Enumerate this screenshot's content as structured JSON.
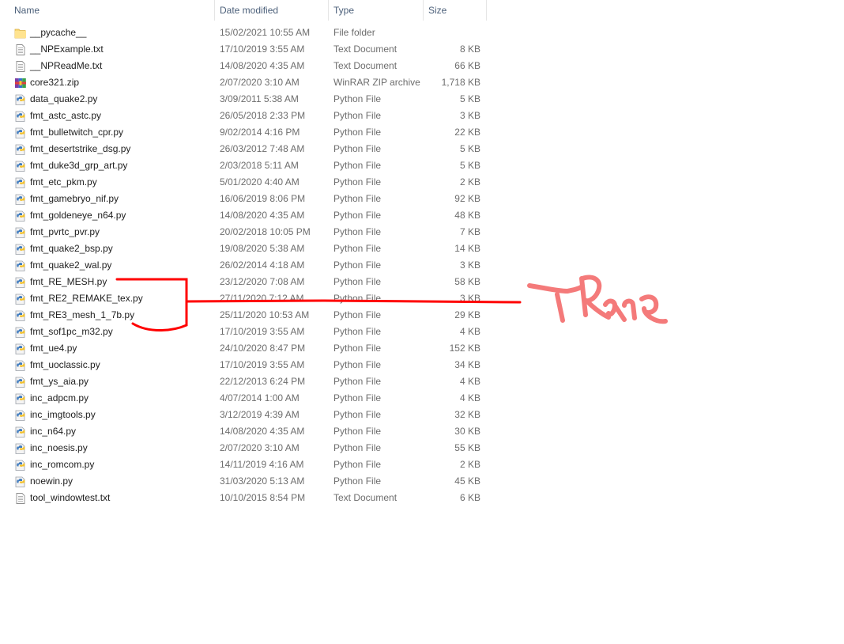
{
  "header": {
    "columns": {
      "name": "Name",
      "date": "Date modified",
      "type": "Type",
      "size": "Size"
    },
    "sort_indicator": "^"
  },
  "files": [
    {
      "name": "__pycache__",
      "date": "15/02/2021 10:55 AM",
      "type": "File folder",
      "size": "",
      "icon": "folder-icon"
    },
    {
      "name": "__NPExample.txt",
      "date": "17/10/2019 3:55 AM",
      "type": "Text Document",
      "size": "8 KB",
      "icon": "text-file-icon"
    },
    {
      "name": "__NPReadMe.txt",
      "date": "14/08/2020 4:35 AM",
      "type": "Text Document",
      "size": "66 KB",
      "icon": "text-file-icon"
    },
    {
      "name": "core321.zip",
      "date": "2/07/2020 3:10 AM",
      "type": "WinRAR ZIP archive",
      "size": "1,718 KB",
      "icon": "winrar-archive-icon"
    },
    {
      "name": "data_quake2.py",
      "date": "3/09/2011 5:38 AM",
      "type": "Python File",
      "size": "5 KB",
      "icon": "python-file-icon"
    },
    {
      "name": "fmt_astc_astc.py",
      "date": "26/05/2018 2:33 PM",
      "type": "Python File",
      "size": "3 KB",
      "icon": "python-file-icon"
    },
    {
      "name": "fmt_bulletwitch_cpr.py",
      "date": "9/02/2014 4:16 PM",
      "type": "Python File",
      "size": "22 KB",
      "icon": "python-file-icon"
    },
    {
      "name": "fmt_desertstrike_dsg.py",
      "date": "26/03/2012 7:48 AM",
      "type": "Python File",
      "size": "5 KB",
      "icon": "python-file-icon"
    },
    {
      "name": "fmt_duke3d_grp_art.py",
      "date": "2/03/2018 5:11 AM",
      "type": "Python File",
      "size": "5 KB",
      "icon": "python-file-icon"
    },
    {
      "name": "fmt_etc_pkm.py",
      "date": "5/01/2020 4:40 AM",
      "type": "Python File",
      "size": "2 KB",
      "icon": "python-file-icon"
    },
    {
      "name": "fmt_gamebryo_nif.py",
      "date": "16/06/2019 8:06 PM",
      "type": "Python File",
      "size": "92 KB",
      "icon": "python-file-icon"
    },
    {
      "name": "fmt_goldeneye_n64.py",
      "date": "14/08/2020 4:35 AM",
      "type": "Python File",
      "size": "48 KB",
      "icon": "python-file-icon"
    },
    {
      "name": "fmt_pvrtc_pvr.py",
      "date": "20/02/2018 10:05 PM",
      "type": "Python File",
      "size": "7 KB",
      "icon": "python-file-icon"
    },
    {
      "name": "fmt_quake2_bsp.py",
      "date": "19/08/2020 5:38 AM",
      "type": "Python File",
      "size": "14 KB",
      "icon": "python-file-icon"
    },
    {
      "name": "fmt_quake2_wal.py",
      "date": "26/02/2014 4:18 AM",
      "type": "Python File",
      "size": "3 KB",
      "icon": "python-file-icon"
    },
    {
      "name": "fmt_RE_MESH.py",
      "date": "23/12/2020 7:08 AM",
      "type": "Python File",
      "size": "58 KB",
      "icon": "python-file-icon"
    },
    {
      "name": "fmt_RE2_REMAKE_tex.py",
      "date": "27/11/2020 7:12 AM",
      "type": "Python File",
      "size": "3 KB",
      "icon": "python-file-icon"
    },
    {
      "name": "fmt_RE3_mesh_1_7b.py",
      "date": "25/11/2020 10:53 AM",
      "type": "Python File",
      "size": "29 KB",
      "icon": "python-file-icon"
    },
    {
      "name": "fmt_sof1pc_m32.py",
      "date": "17/10/2019 3:55 AM",
      "type": "Python File",
      "size": "4 KB",
      "icon": "python-file-icon"
    },
    {
      "name": "fmt_ue4.py",
      "date": "24/10/2020 8:47 PM",
      "type": "Python File",
      "size": "152 KB",
      "icon": "python-file-icon"
    },
    {
      "name": "fmt_uoclassic.py",
      "date": "17/10/2019 3:55 AM",
      "type": "Python File",
      "size": "34 KB",
      "icon": "python-file-icon"
    },
    {
      "name": "fmt_ys_aia.py",
      "date": "22/12/2013 6:24 PM",
      "type": "Python File",
      "size": "4 KB",
      "icon": "python-file-icon"
    },
    {
      "name": "inc_adpcm.py",
      "date": "4/07/2014 1:00 AM",
      "type": "Python File",
      "size": "4 KB",
      "icon": "python-file-icon"
    },
    {
      "name": "inc_imgtools.py",
      "date": "3/12/2019 4:39 AM",
      "type": "Python File",
      "size": "32 KB",
      "icon": "python-file-icon"
    },
    {
      "name": "inc_n64.py",
      "date": "14/08/2020 4:35 AM",
      "type": "Python File",
      "size": "30 KB",
      "icon": "python-file-icon"
    },
    {
      "name": "inc_noesis.py",
      "date": "2/07/2020 3:10 AM",
      "type": "Python File",
      "size": "55 KB",
      "icon": "python-file-icon"
    },
    {
      "name": "inc_romcom.py",
      "date": "14/11/2019 4:16 AM",
      "type": "Python File",
      "size": "2 KB",
      "icon": "python-file-icon"
    },
    {
      "name": "noewin.py",
      "date": "31/03/2020 5:13 AM",
      "type": "Python File",
      "size": "45 KB",
      "icon": "python-file-icon"
    },
    {
      "name": "tool_windowtest.txt",
      "date": "10/10/2015 8:54 PM",
      "type": "Text Document",
      "size": "6 KB",
      "icon": "text-file-icon"
    }
  ],
  "annotation": {
    "handwritten_text": "There",
    "bracket_color": "#ff0000",
    "text_color": "#f47a7a"
  }
}
